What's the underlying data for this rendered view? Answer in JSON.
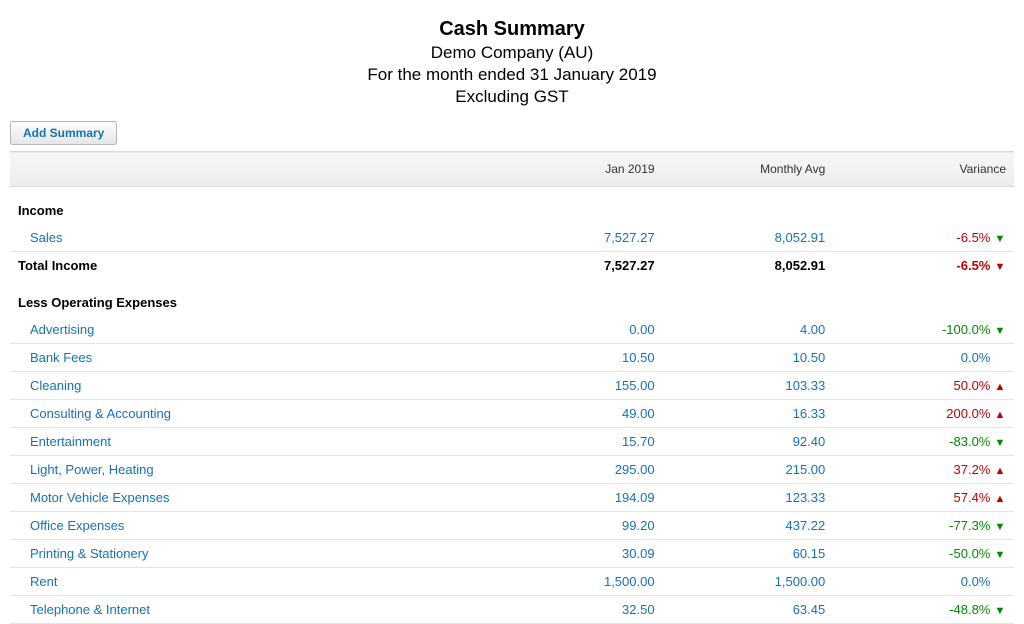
{
  "header": {
    "title": "Cash Summary",
    "company": "Demo Company (AU)",
    "period": "For the month ended 31 January 2019",
    "exclusion": "Excluding GST"
  },
  "buttons": {
    "add_summary": "Add Summary"
  },
  "columns": {
    "c1": "",
    "c2": "Jan 2019",
    "c3": "Monthly Avg",
    "c4": "Variance"
  },
  "sections": [
    {
      "title": "Income",
      "rows": [
        {
          "label": "Sales",
          "current": "7,527.27",
          "avg": "8,052.91",
          "variance": "-6.5%",
          "dir": "down",
          "cls": "pos"
        }
      ],
      "total": {
        "label": "Total Income",
        "current": "7,527.27",
        "avg": "8,052.91",
        "variance": "-6.5%",
        "dir": "down",
        "cls": "neg"
      }
    },
    {
      "title": "Less Operating Expenses",
      "rows": [
        {
          "label": "Advertising",
          "current": "0.00",
          "avg": "4.00",
          "variance": "-100.0%",
          "dir": "down",
          "cls": "neg"
        },
        {
          "label": "Bank Fees",
          "current": "10.50",
          "avg": "10.50",
          "variance": "0.0%",
          "dir": "none",
          "cls": "zero"
        },
        {
          "label": "Cleaning",
          "current": "155.00",
          "avg": "103.33",
          "variance": "50.0%",
          "dir": "up",
          "cls": "pos"
        },
        {
          "label": "Consulting & Accounting",
          "current": "49.00",
          "avg": "16.33",
          "variance": "200.0%",
          "dir": "up",
          "cls": "pos"
        },
        {
          "label": "Entertainment",
          "current": "15.70",
          "avg": "92.40",
          "variance": "-83.0%",
          "dir": "down",
          "cls": "neg"
        },
        {
          "label": "Light, Power, Heating",
          "current": "295.00",
          "avg": "215.00",
          "variance": "37.2%",
          "dir": "up",
          "cls": "pos"
        },
        {
          "label": "Motor Vehicle Expenses",
          "current": "194.09",
          "avg": "123.33",
          "variance": "57.4%",
          "dir": "up",
          "cls": "pos"
        },
        {
          "label": "Office Expenses",
          "current": "99.20",
          "avg": "437.22",
          "variance": "-77.3%",
          "dir": "down",
          "cls": "neg"
        },
        {
          "label": "Printing & Stationery",
          "current": "30.09",
          "avg": "60.15",
          "variance": "-50.0%",
          "dir": "down",
          "cls": "neg"
        },
        {
          "label": "Rent",
          "current": "1,500.00",
          "avg": "1,500.00",
          "variance": "0.0%",
          "dir": "none",
          "cls": "zero"
        },
        {
          "label": "Telephone & Internet",
          "current": "32.50",
          "avg": "63.45",
          "variance": "-48.8%",
          "dir": "down",
          "cls": "neg"
        }
      ]
    }
  ]
}
